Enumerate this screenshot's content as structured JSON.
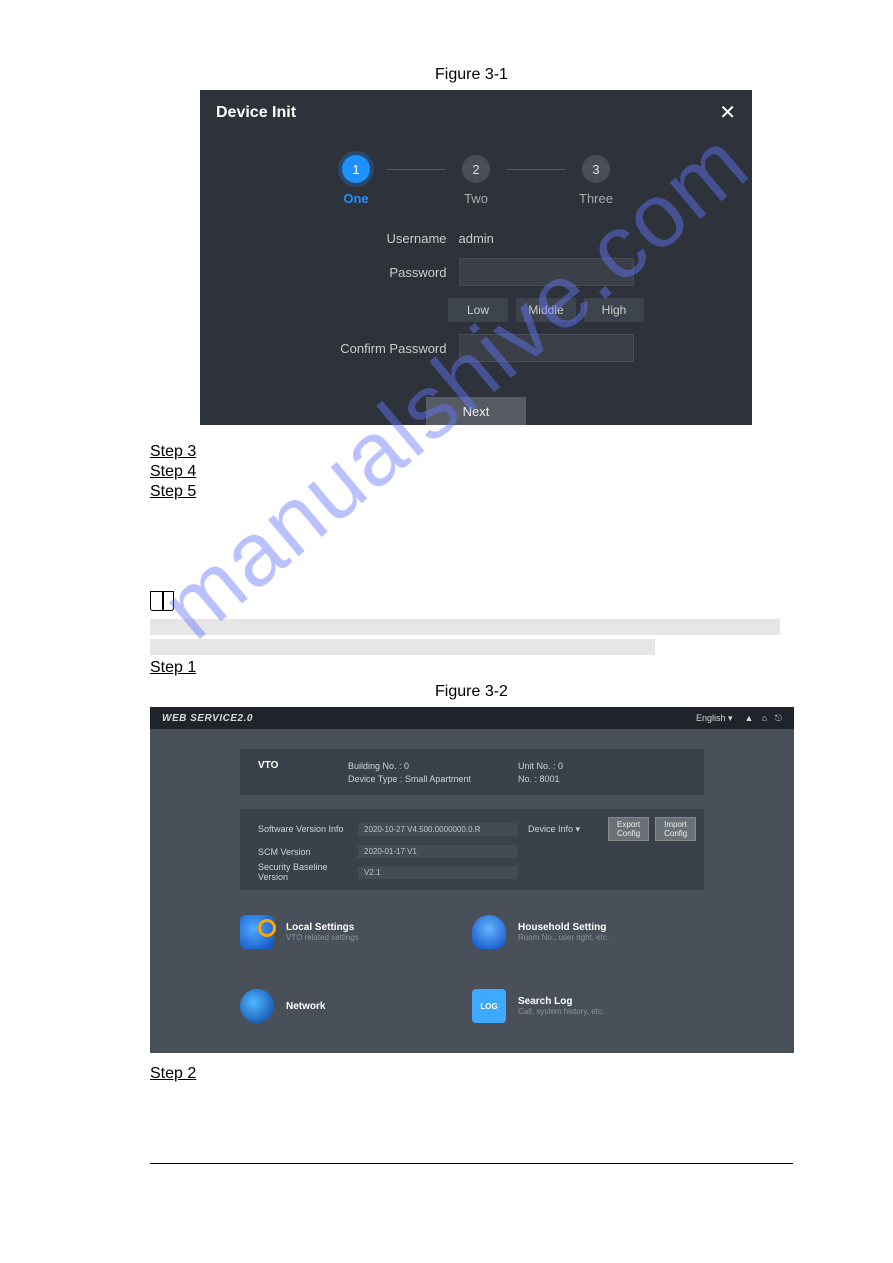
{
  "watermark": "manualshive.com",
  "figure1": {
    "caption": "Figure 3-1",
    "title": "Device Init",
    "steps": [
      {
        "num": "1",
        "label": "One",
        "active": true
      },
      {
        "num": "2",
        "label": "Two",
        "active": false
      },
      {
        "num": "3",
        "label": "Three",
        "active": false
      }
    ],
    "username_label": "Username",
    "username_value": "admin",
    "password_label": "Password",
    "strength": {
      "low": "Low",
      "middle": "Middle",
      "high": "High"
    },
    "confirm_label": "Confirm Password",
    "next": "Next"
  },
  "step_links": {
    "s3": "Step 3",
    "s4": "Step 4",
    "s5": "Step 5",
    "s1": "Step 1",
    "s2": "Step 2"
  },
  "figure2": {
    "caption": "Figure 3-2",
    "logo": "WEB SERVICE2.0",
    "language": "English",
    "panel1": {
      "title": "VTO",
      "building_label": "Building No. : 0",
      "device_type": "Device Type : Small Apartment",
      "unit_label": "Unit No. : 0",
      "no_label": "No. : 8001"
    },
    "panel2": {
      "sw_label": "Software Version Info",
      "sw_val": "2020-10-27 V4.500.0000000.0.R",
      "scm_label": "SCM Version",
      "scm_val": "2020-01-17 V1",
      "sec_label": "Security Baseline Version",
      "sec_val": "V2.1",
      "device_info": "Device Info",
      "export": "Export Config",
      "import": "Import Config"
    },
    "tiles": {
      "local": {
        "title": "Local Settings",
        "sub": "VTO related settings"
      },
      "household": {
        "title": "Household Setting",
        "sub": "Room No., user right, etc."
      },
      "network": {
        "title": "Network",
        "sub": ""
      },
      "searchlog": {
        "title": "Search Log",
        "sub": "Call, system history, etc."
      },
      "log_badge": "LOG"
    }
  }
}
